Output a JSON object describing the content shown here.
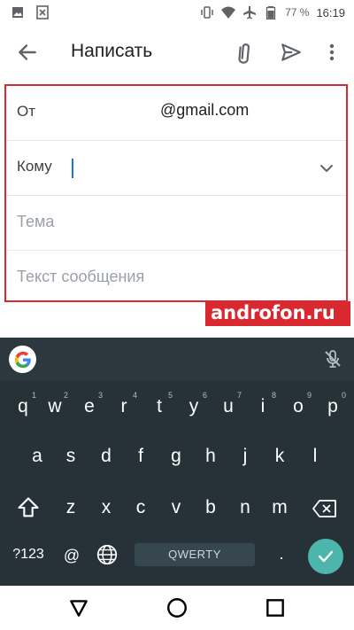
{
  "status_bar": {
    "battery_percent": "77 %",
    "time": "16:19",
    "icons": [
      "image-icon",
      "close-box-icon",
      "vibrate-icon",
      "wifi-icon",
      "airplane-icon",
      "battery-icon"
    ]
  },
  "app_bar": {
    "title": "Написать",
    "icons": [
      "back-arrow-icon",
      "attachment-icon",
      "send-icon",
      "more-vert-icon"
    ]
  },
  "compose": {
    "from_label": "От",
    "from_value": "@gmail.com",
    "to_label": "Кому",
    "subject_placeholder": "Тема",
    "body_placeholder": "Текст сообщения"
  },
  "watermark": {
    "text": "androfon.ru"
  },
  "keyboard": {
    "row1": [
      {
        "key": "q",
        "hint": "1"
      },
      {
        "key": "w",
        "hint": "2"
      },
      {
        "key": "e",
        "hint": "3"
      },
      {
        "key": "r",
        "hint": "4"
      },
      {
        "key": "t",
        "hint": "5"
      },
      {
        "key": "y",
        "hint": "6"
      },
      {
        "key": "u",
        "hint": "7"
      },
      {
        "key": "i",
        "hint": "8"
      },
      {
        "key": "o",
        "hint": "9"
      },
      {
        "key": "p",
        "hint": "0"
      }
    ],
    "row2": [
      "a",
      "s",
      "d",
      "f",
      "g",
      "h",
      "j",
      "k",
      "l"
    ],
    "row3": [
      "z",
      "x",
      "c",
      "v",
      "b",
      "n",
      "m"
    ],
    "symbols_label": "?123",
    "at_label": "@",
    "space_label": "QWERTY",
    "period_label": ".",
    "accent_color": "#4db6ac"
  },
  "colors": {
    "highlight_border": "#d9282f",
    "keyboard_bg": "#263238",
    "caret": "#1a73e8"
  }
}
